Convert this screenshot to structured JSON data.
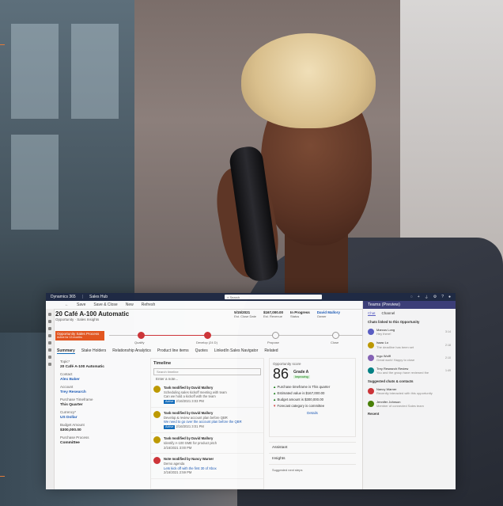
{
  "app": {
    "product": "Dynamics 365",
    "area": "Sales Hub",
    "search_placeholder": "Search"
  },
  "commands": [
    "Save",
    "Save & Close",
    "New",
    "Refresh"
  ],
  "record": {
    "title": "20 Café A-100 Automatic",
    "subtitle": "Opportunity · Sales Insights",
    "stats": [
      {
        "value": "5/15/2021",
        "label": "Est. Close Date"
      },
      {
        "value": "$167,000.00",
        "label": "Est. Revenue"
      },
      {
        "value": "In Progress",
        "label": "Status"
      },
      {
        "value": "David Mallory",
        "label": "Owner"
      }
    ]
  },
  "bpf": {
    "name": "Opportunity Sales Process",
    "active_for": "Active for 13 months",
    "stages": [
      "Qualify",
      "Develop (24 D)",
      "Propose",
      "Close"
    ]
  },
  "tabs": [
    "Summary",
    "Stake Holders",
    "Relationship Analytics",
    "Product line items",
    "Quotes",
    "LinkedIn Sales Navigator",
    "Related"
  ],
  "form_fields": [
    {
      "label": "Topic*",
      "value": "20 Café A-100 Automatic"
    },
    {
      "label": "Contact",
      "value": ""
    },
    {
      "label": "",
      "value": "Alex Baker",
      "link": true
    },
    {
      "label": "Account",
      "value": ""
    },
    {
      "label": "",
      "value": "Trey Research",
      "link": true
    },
    {
      "label": "Purchase Timeframe",
      "value": "This Quarter"
    },
    {
      "label": "Currency*",
      "value": ""
    },
    {
      "label": "",
      "value": "US Dollar",
      "link": true
    },
    {
      "label": "Budget Amount",
      "value": "$300,000.00"
    },
    {
      "label": "Purchase Process",
      "value": "Committee"
    }
  ],
  "timeline": {
    "title": "Timeline",
    "search_placeholder": "Search timeline",
    "enter_note": "Enter a note...",
    "notes": [
      {
        "title": "Task modified by David Mallory",
        "body": "Scheduling sales kickoff meeting with team",
        "detail": "Can we hold a kickoff with the team",
        "badge": "Active",
        "time": "2/16/2021 3:03 PM"
      },
      {
        "title": "Task modified by David Mallory",
        "body": "Develop & review account plan before QBR",
        "detail": "We need to go over the account plan before the QBR",
        "badge": "Active",
        "time": "2/16/2021 3:01 PM"
      },
      {
        "title": "Task modified by David Mallory",
        "body": "Identify A-100 SME for product pitch",
        "detail": "",
        "badge": "",
        "time": "2/16/2021 3:00 PM"
      },
      {
        "title": "Note modified by Nancy Warner",
        "body": "Demo agenda",
        "detail": "Lets kick off with the first 30 of Xbox",
        "badge": "",
        "time": "2/16/2021 2:59 PM",
        "red": true
      }
    ]
  },
  "score": {
    "title": "Opportunity score",
    "value": "86",
    "grade": "Grade A",
    "trend": "Improving",
    "reasons": [
      {
        "text": "Purchase timeframe is This quarter",
        "up": true
      },
      {
        "text": "Estimated value is $167,000.00",
        "up": true
      },
      {
        "text": "Budget amount is $300,000.00",
        "up": true
      },
      {
        "text": "Forecast category is committee",
        "up": false
      }
    ],
    "details": "Details"
  },
  "side": {
    "assistant": "Assistant",
    "insights": "Insights",
    "suggestion": "Suggested next steps"
  },
  "teams": {
    "title": "Teams (Preview)",
    "tabs": [
      "Chat",
      "Channel"
    ],
    "linked_section": "Chats linked to this Opportunity",
    "chats": [
      {
        "name": "Marcus Long",
        "msg": "Hey there!",
        "time": "3:14",
        "color": "#5b5fc7"
      },
      {
        "name": "Isaac Lo",
        "msg": "The deadline has been set",
        "time": "2:18",
        "color": "#c19c00"
      },
      {
        "name": "Ingo Wolff",
        "msg": "Great work! Happy to close",
        "time": "2:10",
        "color": "#8764b8"
      },
      {
        "name": "Trey Research Review",
        "msg": "You and the group have reviewed the",
        "time": "1:49",
        "color": "#038387"
      }
    ],
    "suggested_section": "Suggested chats & contacts",
    "suggested": [
      {
        "name": "Nancy Warner",
        "msg": "Recently interacted with this opportunity",
        "time": "",
        "color": "#d13438"
      },
      {
        "name": "Jennifer Johnson",
        "msg": "Member of connected Sales team",
        "time": "",
        "color": "#498205"
      }
    ],
    "recent": "Recent"
  }
}
